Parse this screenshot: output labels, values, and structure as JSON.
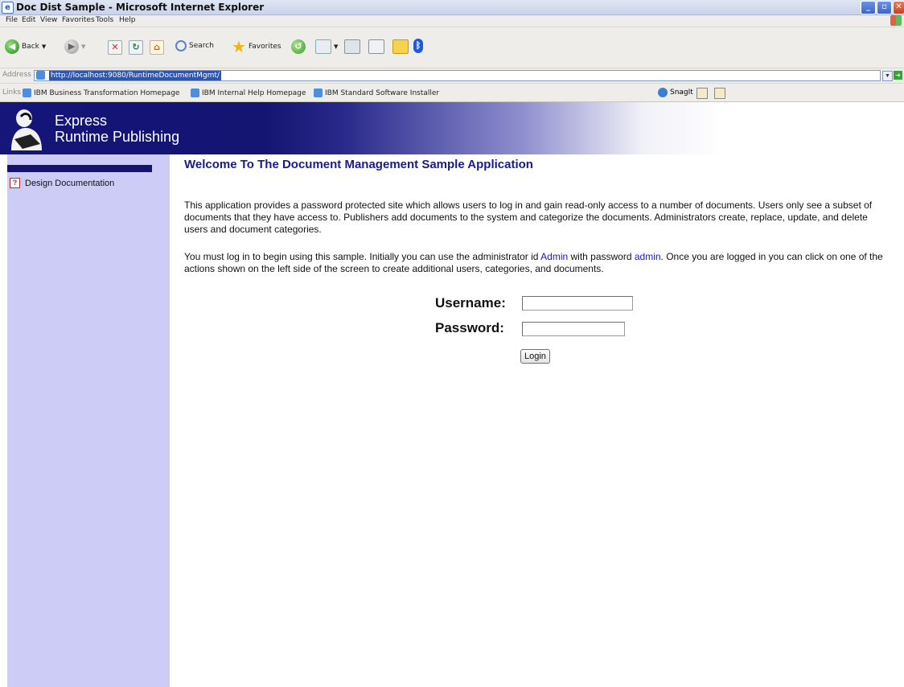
{
  "window": {
    "title": "Doc Dist Sample - Microsoft Internet Explorer",
    "controls": {
      "minimize": "_",
      "maximize": "▫",
      "close": "✕"
    }
  },
  "menu": [
    "File",
    "Edit",
    "View",
    "Favorites",
    "Tools",
    "Help"
  ],
  "toolbar": {
    "back_label": "Back",
    "search_label": "Search",
    "favorites_label": "Favorites"
  },
  "address": {
    "label": "Address",
    "url": "http://localhost:9080/RuntimeDocumentMgmt/",
    "go_label": "Go"
  },
  "links": {
    "label": "Links",
    "items": [
      "IBM Business Transformation Homepage",
      "IBM Internal Help Homepage",
      "IBM Standard Software Installer"
    ],
    "snagit_label": "SnagIt"
  },
  "banner": {
    "line1": "Express",
    "line2": "Runtime Publishing"
  },
  "sidebar": {
    "items": [
      {
        "label": "Design Documentation",
        "icon": "help-icon"
      }
    ]
  },
  "main": {
    "heading": "Welcome To The Document Management Sample Application",
    "paragraph1": "This application provides a password protected site which allows users to log in and gain read-only access to a number of documents. Users only see a subset of documents that they have access to. Publishers add documents to the system and categorize the documents. Administrators create, replace, update, and delete users and document categories.",
    "paragraph2": {
      "before_id": "You must log in to begin using this sample. Initially you can use the administrator id ",
      "admin_id": "Admin",
      "between": " with password ",
      "admin_password": "admin",
      "after": ". Once you are logged in you can click on one of the actions shown on the left side of the screen to create additional users, categories, and documents."
    },
    "login": {
      "username_label": "Username:",
      "username_value": "",
      "password_label": "Password:",
      "password_value": "",
      "button_label": "Login"
    }
  }
}
